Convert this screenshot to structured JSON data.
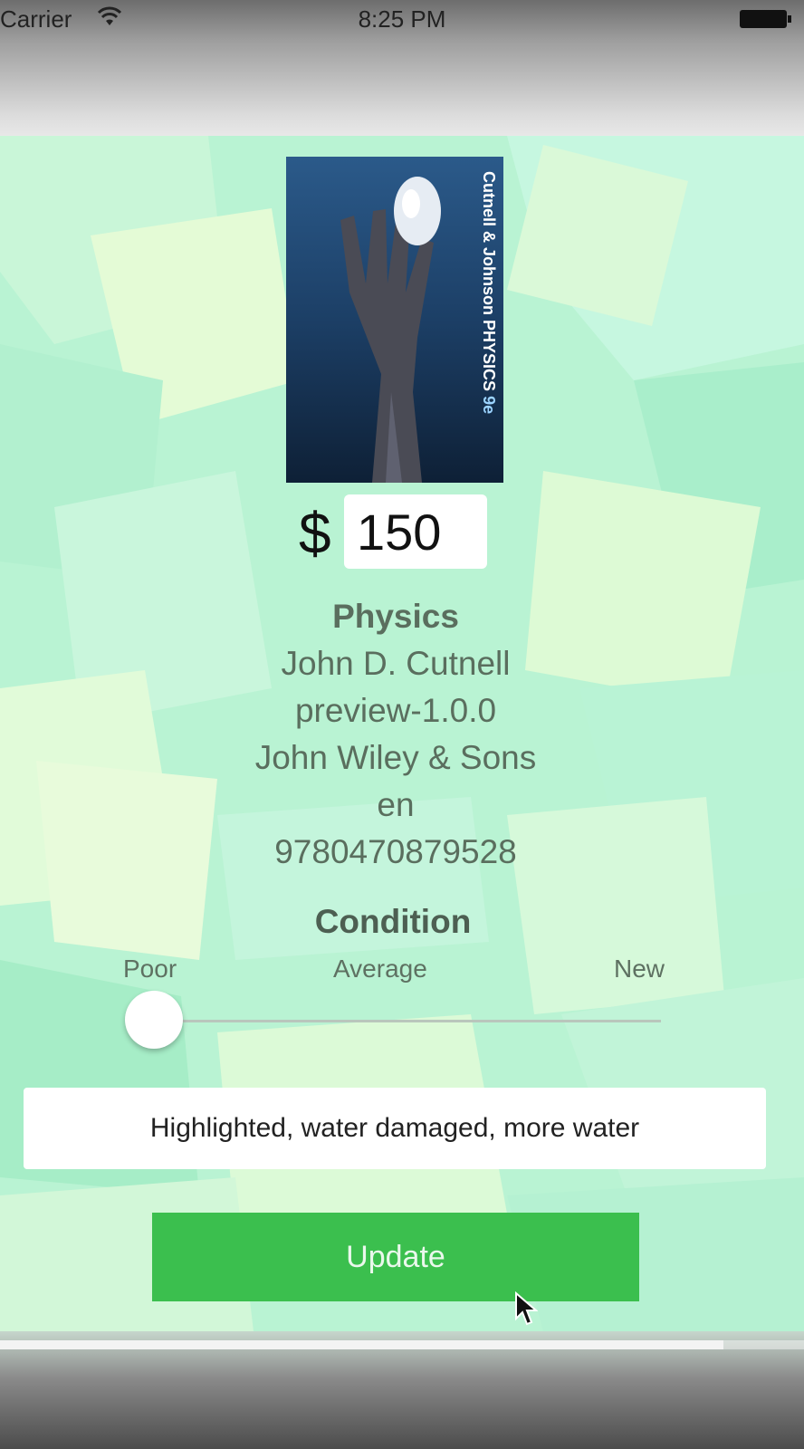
{
  "status_bar": {
    "carrier": "Carrier",
    "time": "8:25 PM",
    "icons": [
      "wifi-icon",
      "battery-icon"
    ]
  },
  "book": {
    "cover": {
      "spine_authors": "Cutnell & Johnson",
      "spine_title": "PHYSICS",
      "spine_edition": "9e",
      "background_color": "#1c3a5e"
    },
    "currency_symbol": "$",
    "price": "150",
    "title": "Physics",
    "author": "John D. Cutnell",
    "edition": "preview-1.0.0",
    "publisher": "John Wiley & Sons",
    "language": "en",
    "isbn": "9780470879528"
  },
  "condition": {
    "heading": "Condition",
    "labels": [
      "Poor",
      "Average",
      "New"
    ],
    "value": 0
  },
  "notes": {
    "value": "Highlighted, water damaged, more water"
  },
  "actions": {
    "update_label": "Update"
  },
  "playback_progress": 0.9,
  "colors": {
    "background": "#b9f3d3",
    "button": "#3bbf4e",
    "text": "#5a6e5e"
  }
}
